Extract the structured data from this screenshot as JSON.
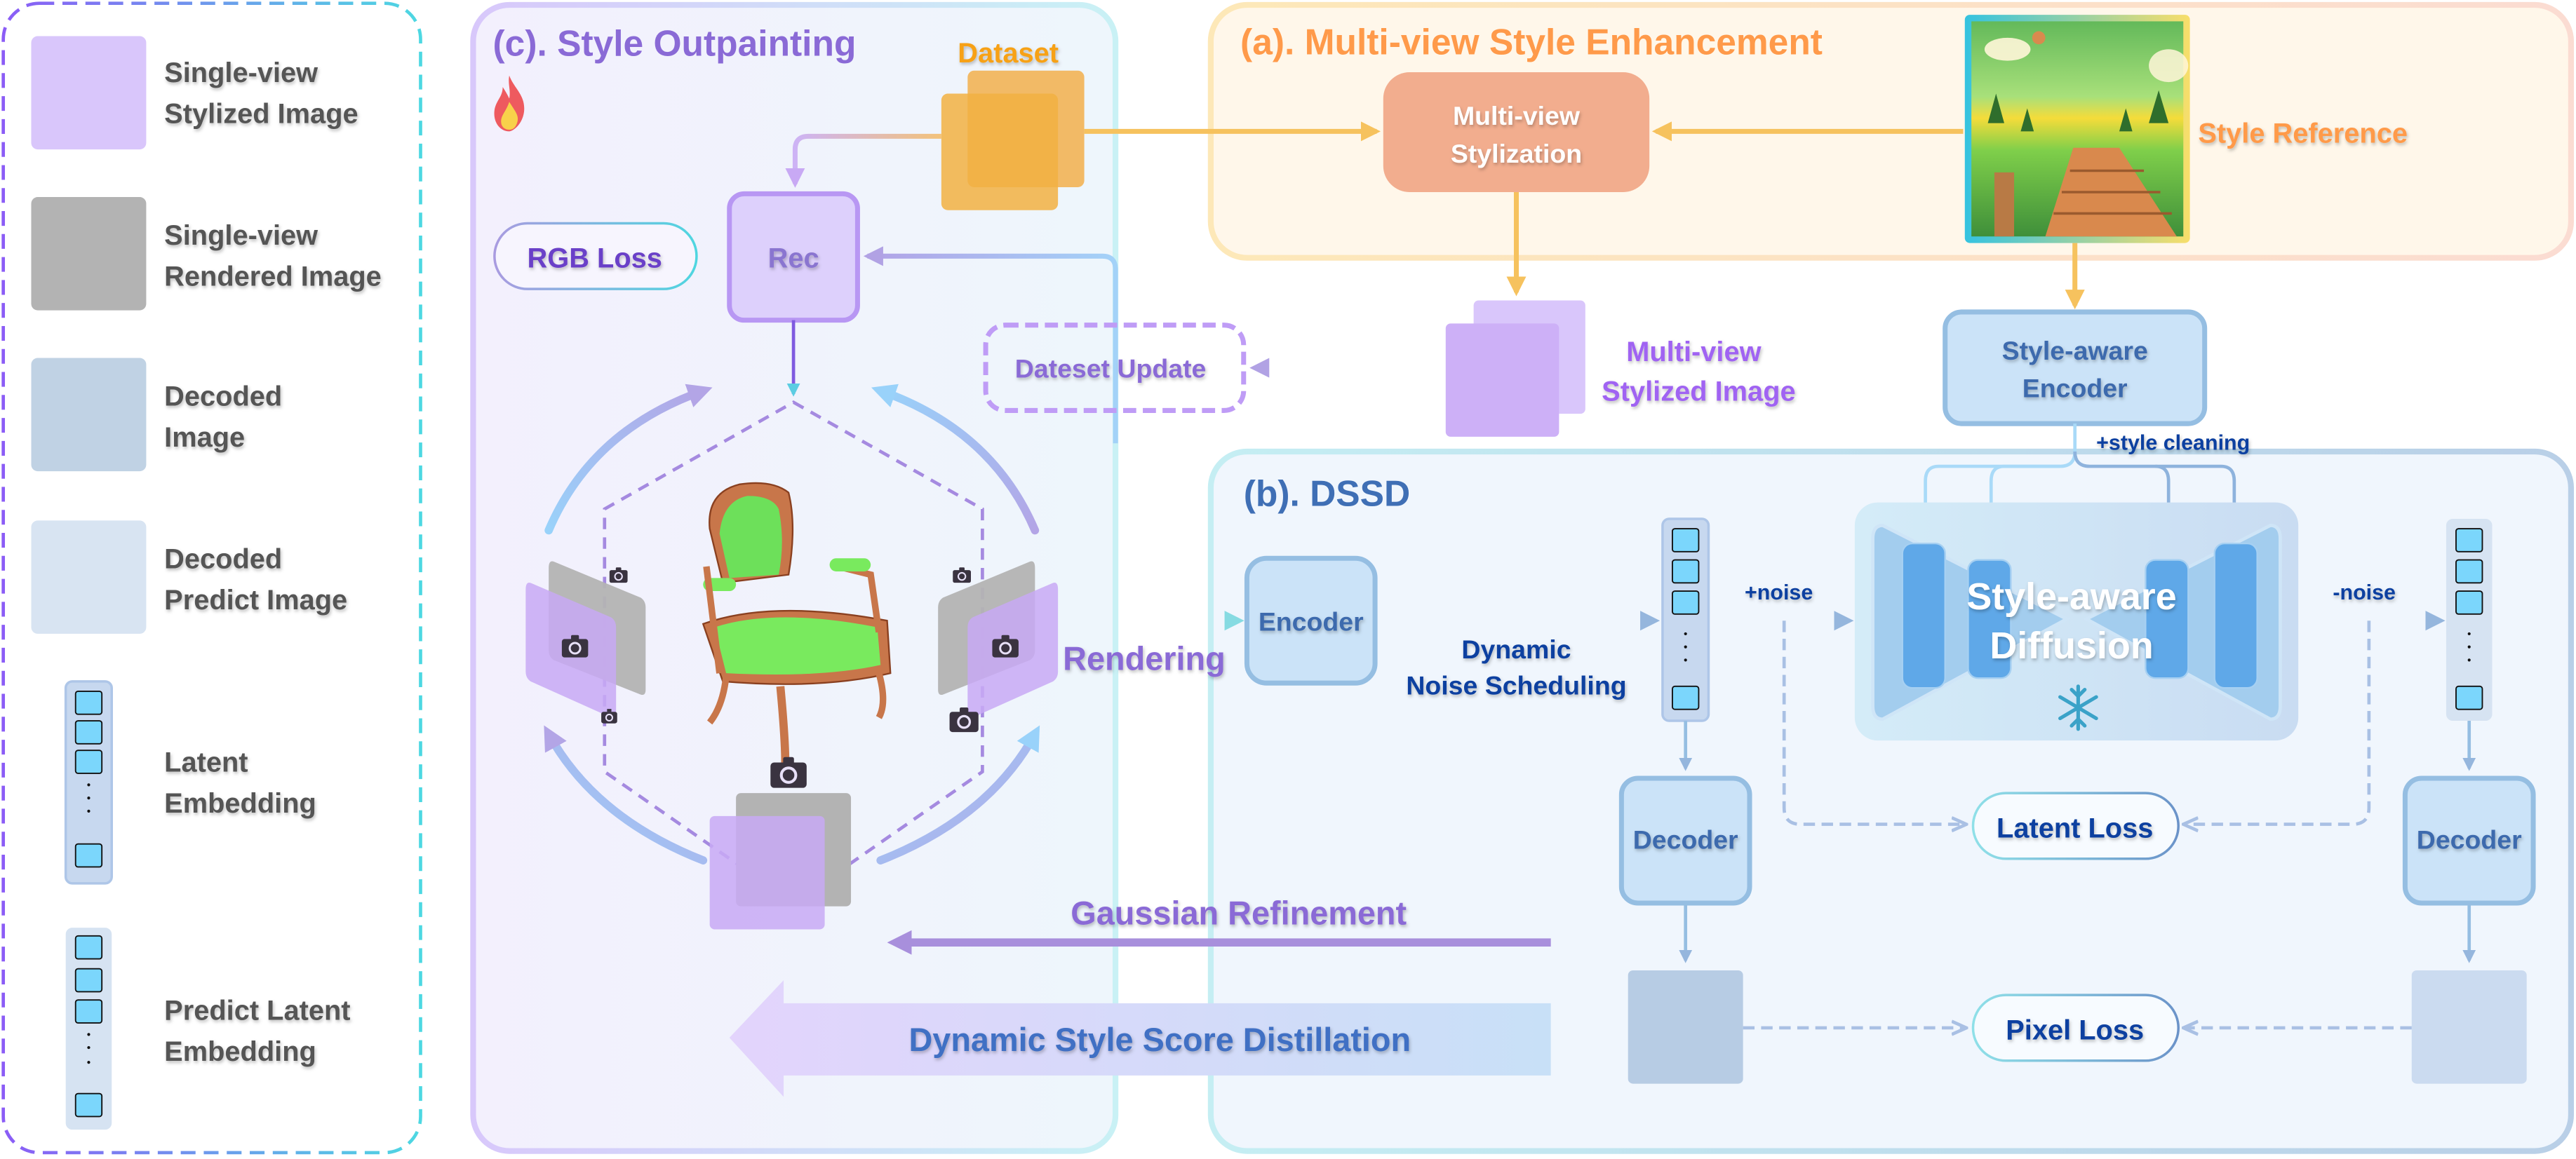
{
  "legend": {
    "items": [
      {
        "label_lines": [
          "Single-view",
          "Stylized Image"
        ],
        "swatch": "#d9c6fb"
      },
      {
        "label_lines": [
          "Single-view",
          "Rendered Image"
        ],
        "swatch": "#b3b3b3"
      },
      {
        "label_lines": [
          "Decoded",
          "Image"
        ],
        "swatch": "#c0d2e4"
      },
      {
        "label_lines": [
          "Decoded",
          "Predict Image"
        ],
        "swatch": "#d8e4f2"
      },
      {
        "label_lines": [
          "Latent",
          "Embedding"
        ],
        "swatch": "#c7d8ef"
      },
      {
        "label_lines": [
          "Predict Latent",
          "Embedding"
        ],
        "swatch": "#d6e3f2"
      }
    ]
  },
  "section_c": {
    "title": "(c). Style Outpainting",
    "dataset_label": "Dataset",
    "rec_label": "Rec",
    "rgb_loss_label": "RGB Loss",
    "dataset_update_label": "Dateset Update",
    "rendering_label": "Rendering",
    "icons": [
      "fire-icon",
      "camera-icon"
    ]
  },
  "section_a": {
    "title": "(a). Multi-view Style Enhancement",
    "stylization_lines": [
      "Multi-view",
      "Stylization"
    ],
    "style_reference_label": "Style Reference",
    "stylized_image_lines": [
      "Multi-view",
      "Stylized Image"
    ]
  },
  "section_b": {
    "title": "(b). DSSD",
    "encoder_label": "Encoder",
    "style_encoder_lines": [
      "Style-aware",
      "Encoder"
    ],
    "style_cleaning_label": "+style cleaning",
    "noise_sched_lines": [
      "Dynamic",
      "Noise Scheduling"
    ],
    "plus_noise_label": "+noise",
    "minus_noise_label": "-noise",
    "diffusion_lines": [
      "Style-aware",
      "Diffusion"
    ],
    "decoder_label": "Decoder",
    "latent_loss_label": "Latent Loss",
    "pixel_loss_label": "Pixel Loss",
    "snowflake_icon": "snowflake-icon"
  },
  "bottom": {
    "gaussian_refinement_label": "Gaussian Refinement",
    "dssd_label": "Dynamic Style Score Distillation"
  },
  "colors": {
    "orange_title": "#ff9a4a",
    "purple_title": "#8a6ad6",
    "blue_title": "#3f6fb5",
    "dark_blue_text": "#0a3fa0",
    "latent_cell": "#7bd6fc"
  }
}
